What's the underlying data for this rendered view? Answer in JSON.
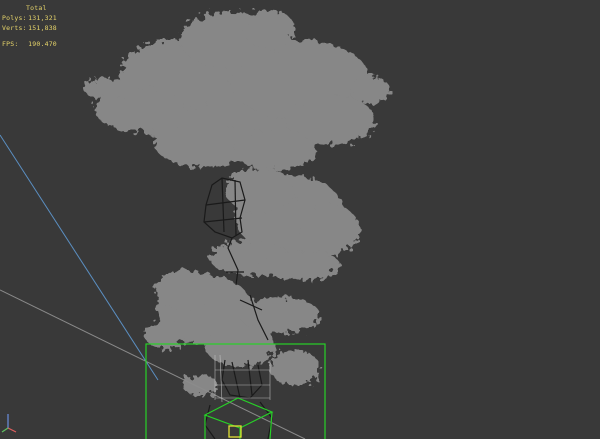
{
  "stats": {
    "title": "Total",
    "polys_label": "Polys:",
    "polys_value": "131,321",
    "verts_label": "Verts:",
    "verts_value": "151,838",
    "fps_label": "FPS:",
    "fps_value": "190.470"
  },
  "colors": {
    "background": "#393939",
    "stats_text": "#e6d46a",
    "foliage": "#8c8c8c",
    "selection_box": "#27d127",
    "gizmo_yellow": "#e2e234",
    "axis_blue": "#5b8fc2",
    "axis_grey": "#8a8a8a"
  },
  "icons": [
    "axis-tripod-icon"
  ]
}
